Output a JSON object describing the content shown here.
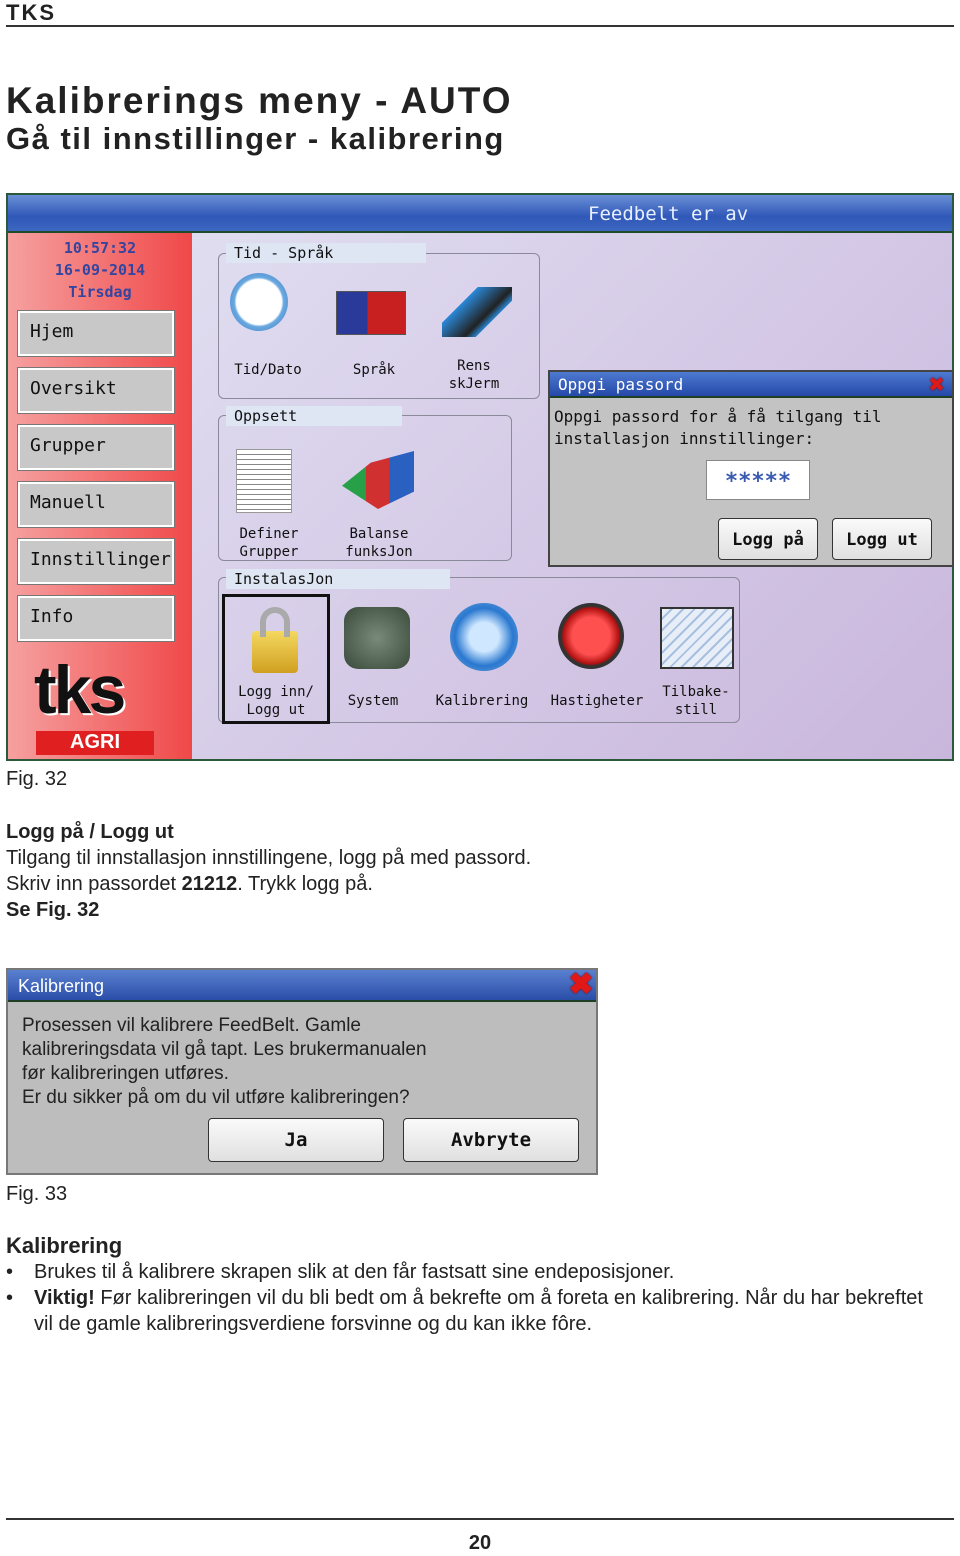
{
  "header": {
    "brand": "TKS"
  },
  "title": "Kalibrerings meny - AUTO",
  "subtitle": "Gå til innstillinger - kalibrering",
  "fig32": {
    "topbar": {
      "status": "Feedbelt er av"
    },
    "clock": {
      "time": "10:57:32",
      "date": "16-09-2014",
      "day": "Tirsdag"
    },
    "menu": [
      "Hjem",
      "Oversikt",
      "Grupper",
      "Manuell",
      "Innstillinger",
      "Info"
    ],
    "logo": {
      "text": "tks",
      "sub": "AGRI"
    },
    "groups": {
      "tid_sprak": {
        "label": "Tid - Språk",
        "items": [
          "Tid/Dato",
          "Språk",
          "Rens\nskJerm"
        ]
      },
      "oppsett": {
        "label": "Oppsett",
        "items": [
          "Definer\nGrupper",
          "Balanse\nfunksJon"
        ]
      },
      "instalasjon": {
        "label": "InstalasJon",
        "items": [
          "Logg inn/\nLogg ut",
          "System",
          "Kalibrering",
          "Hastigheter",
          "Tilbake-\nstill"
        ]
      }
    },
    "password_dialog": {
      "title": "Oppgi passord",
      "message": "Oppgi passord for å få tilgang til installasjon innstillinger:",
      "value": "*****",
      "login": "Logg på",
      "logout": "Logg ut"
    },
    "caption": "Fig. 32"
  },
  "section1": {
    "heading": "Logg på / Logg ut",
    "line1": "Tilgang til innstallasjon innstillingene, logg på med passord.",
    "line2_a": "Skriv inn passordet ",
    "password": "21212",
    "line2_b": ". Trykk logg på.",
    "ref": "Se Fig. 32"
  },
  "fig33": {
    "title": "Kalibrering",
    "message": [
      "Prosessen vil kalibrere FeedBelt. Gamle",
      "kalibreringsdata vil gå tapt. Les brukermanualen",
      "før kalibreringen utføres.",
      "Er du sikker på om du vil utføre kalibreringen?"
    ],
    "yes": "Ja",
    "cancel": "Avbryte",
    "caption": "Fig. 33"
  },
  "section2": {
    "heading": "Kalibrering",
    "bullet1": "Brukes til å kalibrere skrapen slik at den får fastsatt sine endeposisjoner.",
    "bullet2_bold": "Viktig!",
    "bullet2": " Før kalibreringen vil du bli bedt om å bekrefte om å foreta en kalibrering. Når du har bekreftet vil de gamle kalibreringsverdiene forsvinne og du kan ikke fôre."
  },
  "footer": {
    "page": "20"
  },
  "colors": {
    "topbar": "#2f58b8",
    "sidebar": "#f04848",
    "dialog_bar": "#2448a8",
    "close": "#e01818"
  }
}
